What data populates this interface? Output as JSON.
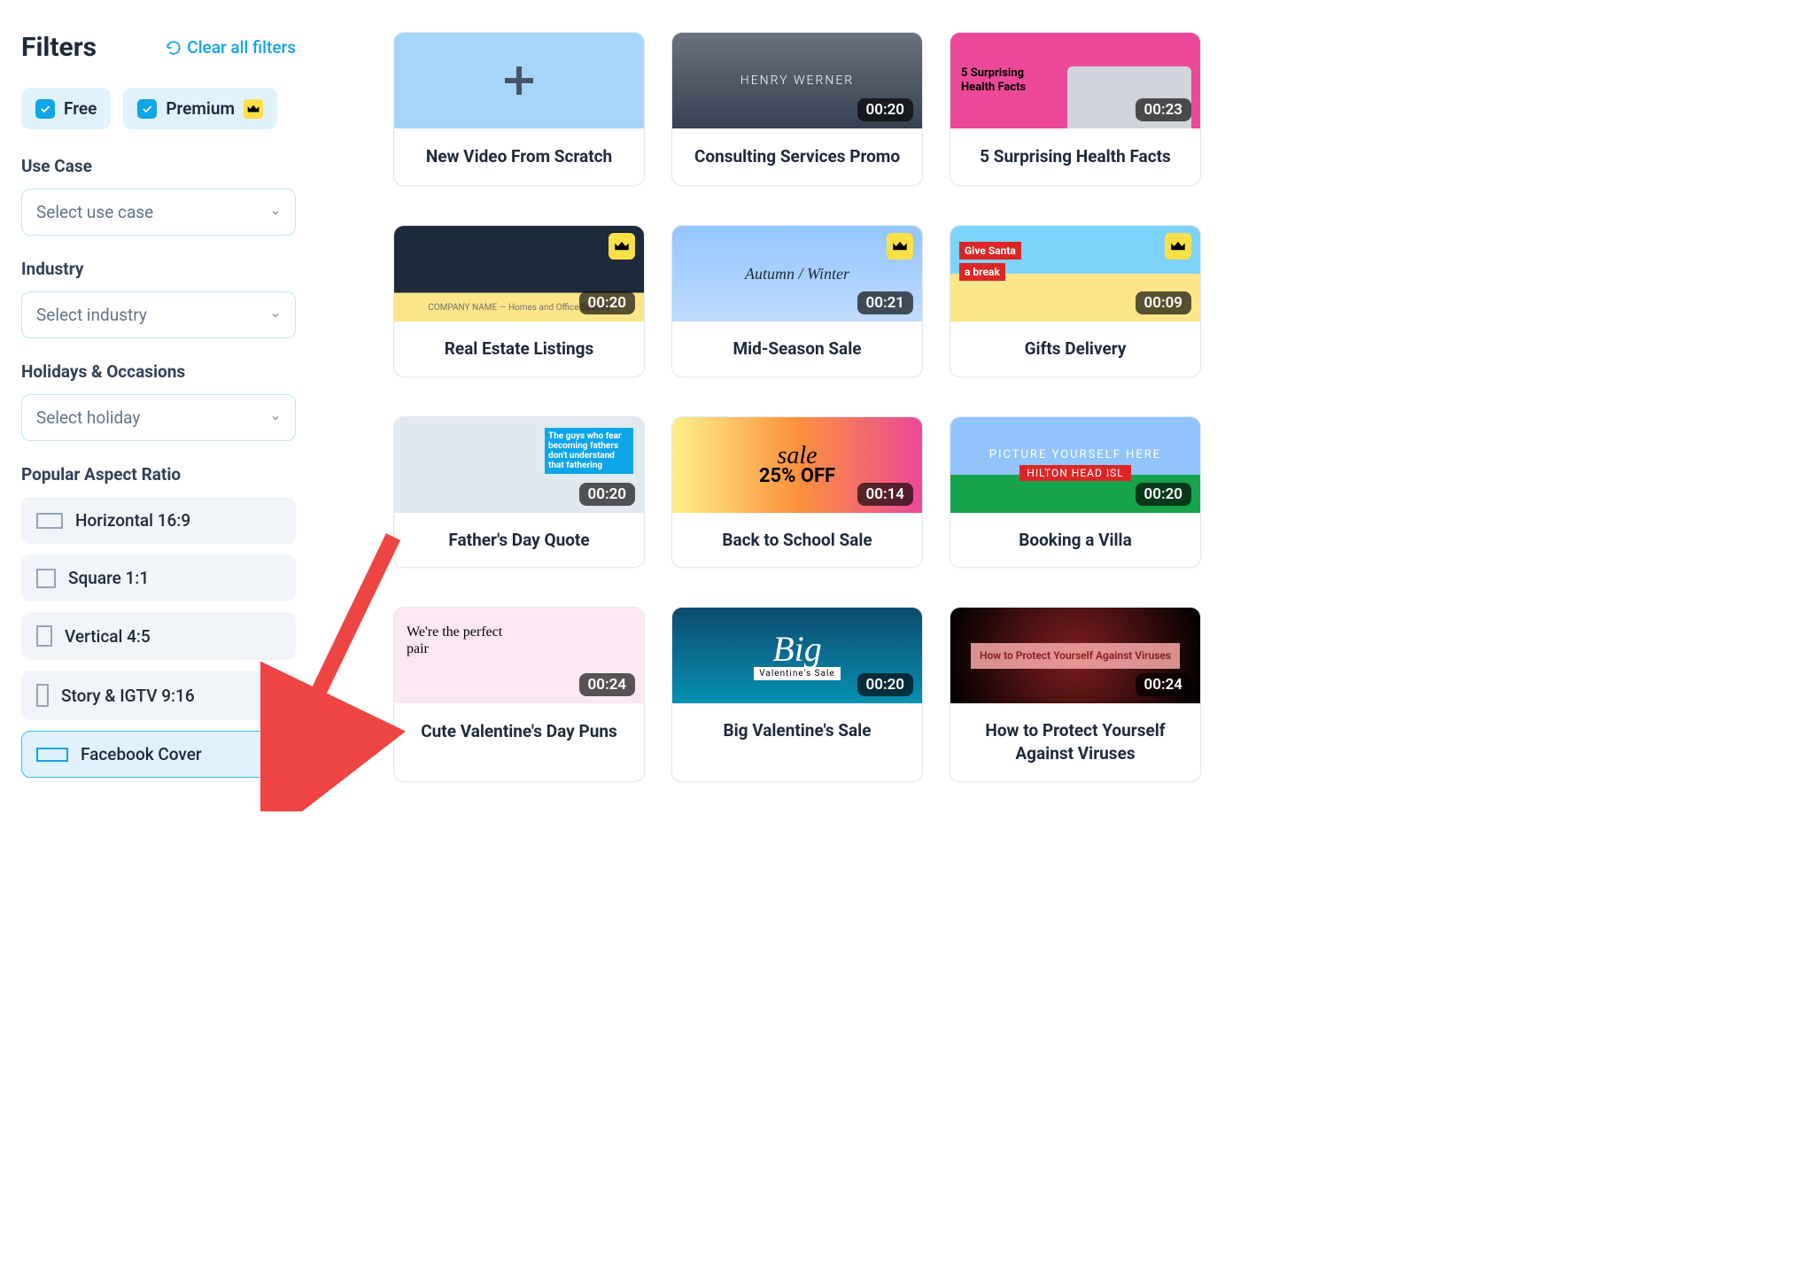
{
  "sidebar": {
    "title": "Filters",
    "clear_label": "Clear all filters",
    "free_label": "Free",
    "premium_label": "Premium",
    "usecase_label": "Use Case",
    "usecase_placeholder": "Select use case",
    "industry_label": "Industry",
    "industry_placeholder": "Select industry",
    "holidays_label": "Holidays & Occasions",
    "holidays_placeholder": "Select holiday",
    "ratio_label": "Popular Aspect Ratio",
    "ratios": {
      "r0": "Horizontal 16:9",
      "r1": "Square 1:1",
      "r2": "Vertical 4:5",
      "r3": "Story & IGTV 9:16",
      "r4": "Facebook Cover"
    }
  },
  "cards": {
    "c0": {
      "title": "New Video From Scratch"
    },
    "c1": {
      "title": "Consulting Services Promo",
      "duration": "00:20",
      "thumb_text": "HENRY WERNER"
    },
    "c2": {
      "title": "5 Surprising Health Facts",
      "duration": "00:23",
      "thumb_text": "5 Surprising Health Facts"
    },
    "c3": {
      "title": "Real Estate Listings",
      "duration": "00:20",
      "thumb_text": "COMPANY NAME — Homes and Office Spaces"
    },
    "c4": {
      "title": "Mid-Season Sale",
      "duration": "00:21",
      "thumb_text": "Autumn / Winter"
    },
    "c5": {
      "title": "Gifts Delivery",
      "duration": "00:09",
      "thumb_text1": "Give Santa",
      "thumb_text2": "a break"
    },
    "c6": {
      "title": "Father's Day Quote",
      "duration": "00:20",
      "thumb_text": "The guys who fear becoming fathers don't understand that fathering"
    },
    "c7": {
      "title": "Back to School Sale",
      "duration": "00:14",
      "thumb_text1": "sale",
      "thumb_text2": "25% OFF"
    },
    "c8": {
      "title": "Booking a Villa",
      "duration": "00:20",
      "thumb_text1": "PICTURE YOURSELF HERE",
      "thumb_text2": "HILTON HEAD ISL"
    },
    "c9": {
      "title": "Cute Valentine's Day Puns",
      "duration": "00:24",
      "thumb_text": "We're the perfect pair"
    },
    "c10": {
      "title": "Big Valentine's Sale",
      "duration": "00:20",
      "thumb_text1": "Big",
      "thumb_text2": "Valentine's Sale"
    },
    "c11": {
      "title": "How to Protect Your­self Against Viruses",
      "duration": "00:24",
      "thumb_text": "How to Protect Yourself Against Viruses"
    }
  }
}
